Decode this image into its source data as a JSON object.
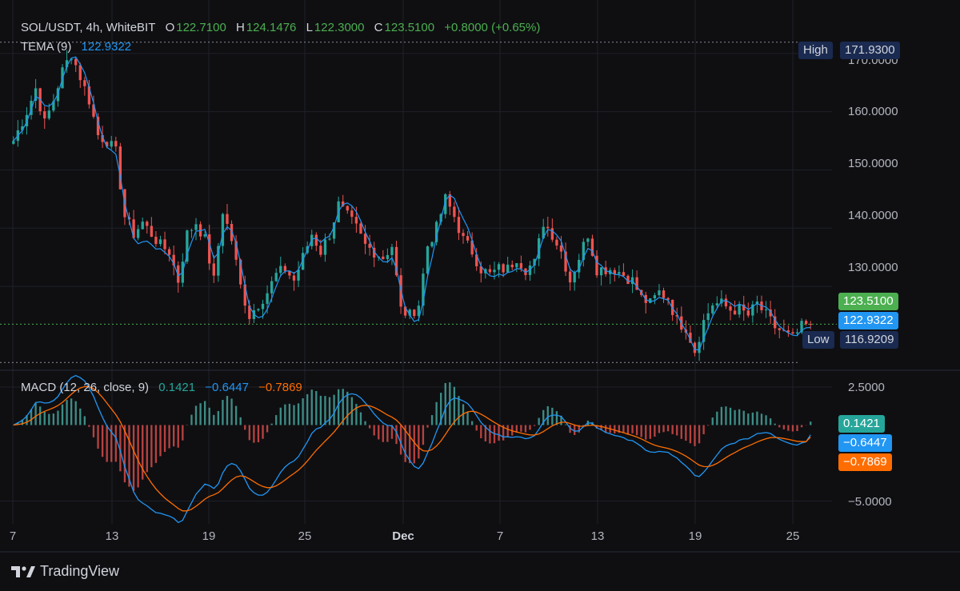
{
  "header": {
    "symbol": "SOL/USDT, 4h, WhiteBIT",
    "o_label": "O",
    "o_value": "122.7100",
    "h_label": "H",
    "h_value": "124.1476",
    "l_label": "L",
    "l_value": "122.3000",
    "c_label": "C",
    "c_value": "123.5100",
    "change": "+0.8000 (+0.65%)"
  },
  "tema_legend": {
    "label": "TEMA (9)",
    "value": "122.9322"
  },
  "macd_legend": {
    "label": "MACD (12, 26, close, 9)",
    "hist": "0.1421",
    "macd": "−0.6447",
    "signal": "−0.7869"
  },
  "price_tags": {
    "high_label": "High",
    "high_value": "171.9300",
    "low_label": "Low",
    "low_value": "116.9209",
    "last_value": "123.5100",
    "tema_value": "122.9322"
  },
  "macd_tags": {
    "hist": "0.1421",
    "macd": "−0.6447",
    "signal": "−0.7869"
  },
  "brand": {
    "name": "TradingView"
  },
  "colors": {
    "up": "#26a69a",
    "down": "#ef5350",
    "tema": "#2196f3",
    "macd": "#2196f3",
    "signal": "#ff6d00",
    "background": "#0f0f12"
  },
  "chart_data": [
    {
      "type": "candlestick",
      "title": "SOL/USDT, 4h, WhiteBIT",
      "y_ticks": [
        "170.0000",
        "160.0000",
        "150.0000",
        "140.0000",
        "130.0000"
      ],
      "ylim": [
        116,
        173
      ],
      "x_ticks": [
        "7",
        "13",
        "19",
        "25",
        "Dec",
        "7",
        "13",
        "19",
        "25"
      ],
      "high": 171.93,
      "low": 116.9209,
      "last": 123.51,
      "tema_last": 122.9322,
      "close_path": [
        [
          0,
          155
        ],
        [
          3,
          160
        ],
        [
          5,
          164
        ],
        [
          7,
          158
        ],
        [
          9,
          162
        ],
        [
          11,
          167
        ],
        [
          13,
          170
        ],
        [
          15,
          166
        ],
        [
          17,
          162
        ],
        [
          19,
          156
        ],
        [
          21,
          155
        ],
        [
          23,
          153
        ],
        [
          25,
          142
        ],
        [
          27,
          139
        ],
        [
          29,
          141
        ],
        [
          31,
          139
        ],
        [
          33,
          137
        ],
        [
          35,
          136
        ],
        [
          37,
          131
        ],
        [
          39,
          139
        ],
        [
          41,
          141
        ],
        [
          43,
          138
        ],
        [
          45,
          131
        ],
        [
          47,
          143
        ],
        [
          49,
          138
        ],
        [
          51,
          130
        ],
        [
          53,
          125
        ],
        [
          55,
          127
        ],
        [
          57,
          129
        ],
        [
          59,
          132
        ],
        [
          61,
          133
        ],
        [
          63,
          131
        ],
        [
          65,
          135
        ],
        [
          67,
          139
        ],
        [
          69,
          136
        ],
        [
          71,
          139
        ],
        [
          73,
          144
        ],
        [
          75,
          142
        ],
        [
          77,
          140
        ],
        [
          79,
          137
        ],
        [
          81,
          136
        ],
        [
          83,
          135
        ],
        [
          85,
          137
        ],
        [
          87,
          126
        ],
        [
          89,
          125
        ],
        [
          91,
          127
        ],
        [
          93,
          137
        ],
        [
          95,
          140
        ],
        [
          97,
          145
        ],
        [
          99,
          142
        ],
        [
          101,
          138
        ],
        [
          103,
          136
        ],
        [
          105,
          133
        ],
        [
          107,
          132
        ],
        [
          109,
          133
        ],
        [
          111,
          133
        ],
        [
          113,
          135
        ],
        [
          115,
          133
        ],
        [
          117,
          134
        ],
        [
          119,
          141
        ],
        [
          121,
          139
        ],
        [
          123,
          136
        ],
        [
          125,
          131
        ],
        [
          127,
          135
        ],
        [
          129,
          139
        ],
        [
          131,
          133
        ],
        [
          133,
          133
        ],
        [
          135,
          133
        ],
        [
          137,
          132
        ],
        [
          139,
          131
        ],
        [
          141,
          128
        ],
        [
          143,
          127
        ],
        [
          145,
          129
        ],
        [
          147,
          128
        ],
        [
          149,
          124
        ],
        [
          151,
          123
        ],
        [
          153,
          119
        ],
        [
          155,
          124
        ],
        [
          157,
          127
        ],
        [
          159,
          127
        ],
        [
          161,
          126
        ],
        [
          163,
          126
        ],
        [
          165,
          125
        ],
        [
          167,
          127
        ],
        [
          169,
          125
        ],
        [
          171,
          123
        ],
        [
          173,
          122
        ],
        [
          175,
          121
        ],
        [
          177,
          123
        ],
        [
          179,
          123.51
        ]
      ]
    },
    {
      "type": "macd",
      "title": "MACD (12, 26, close, 9)",
      "y_ticks": [
        "2.5000",
        "−5.0000"
      ],
      "ylim": [
        -6.5,
        3.5
      ],
      "hist_last": 0.1421,
      "macd_last": -0.6447,
      "signal_last": -0.7869
    }
  ]
}
